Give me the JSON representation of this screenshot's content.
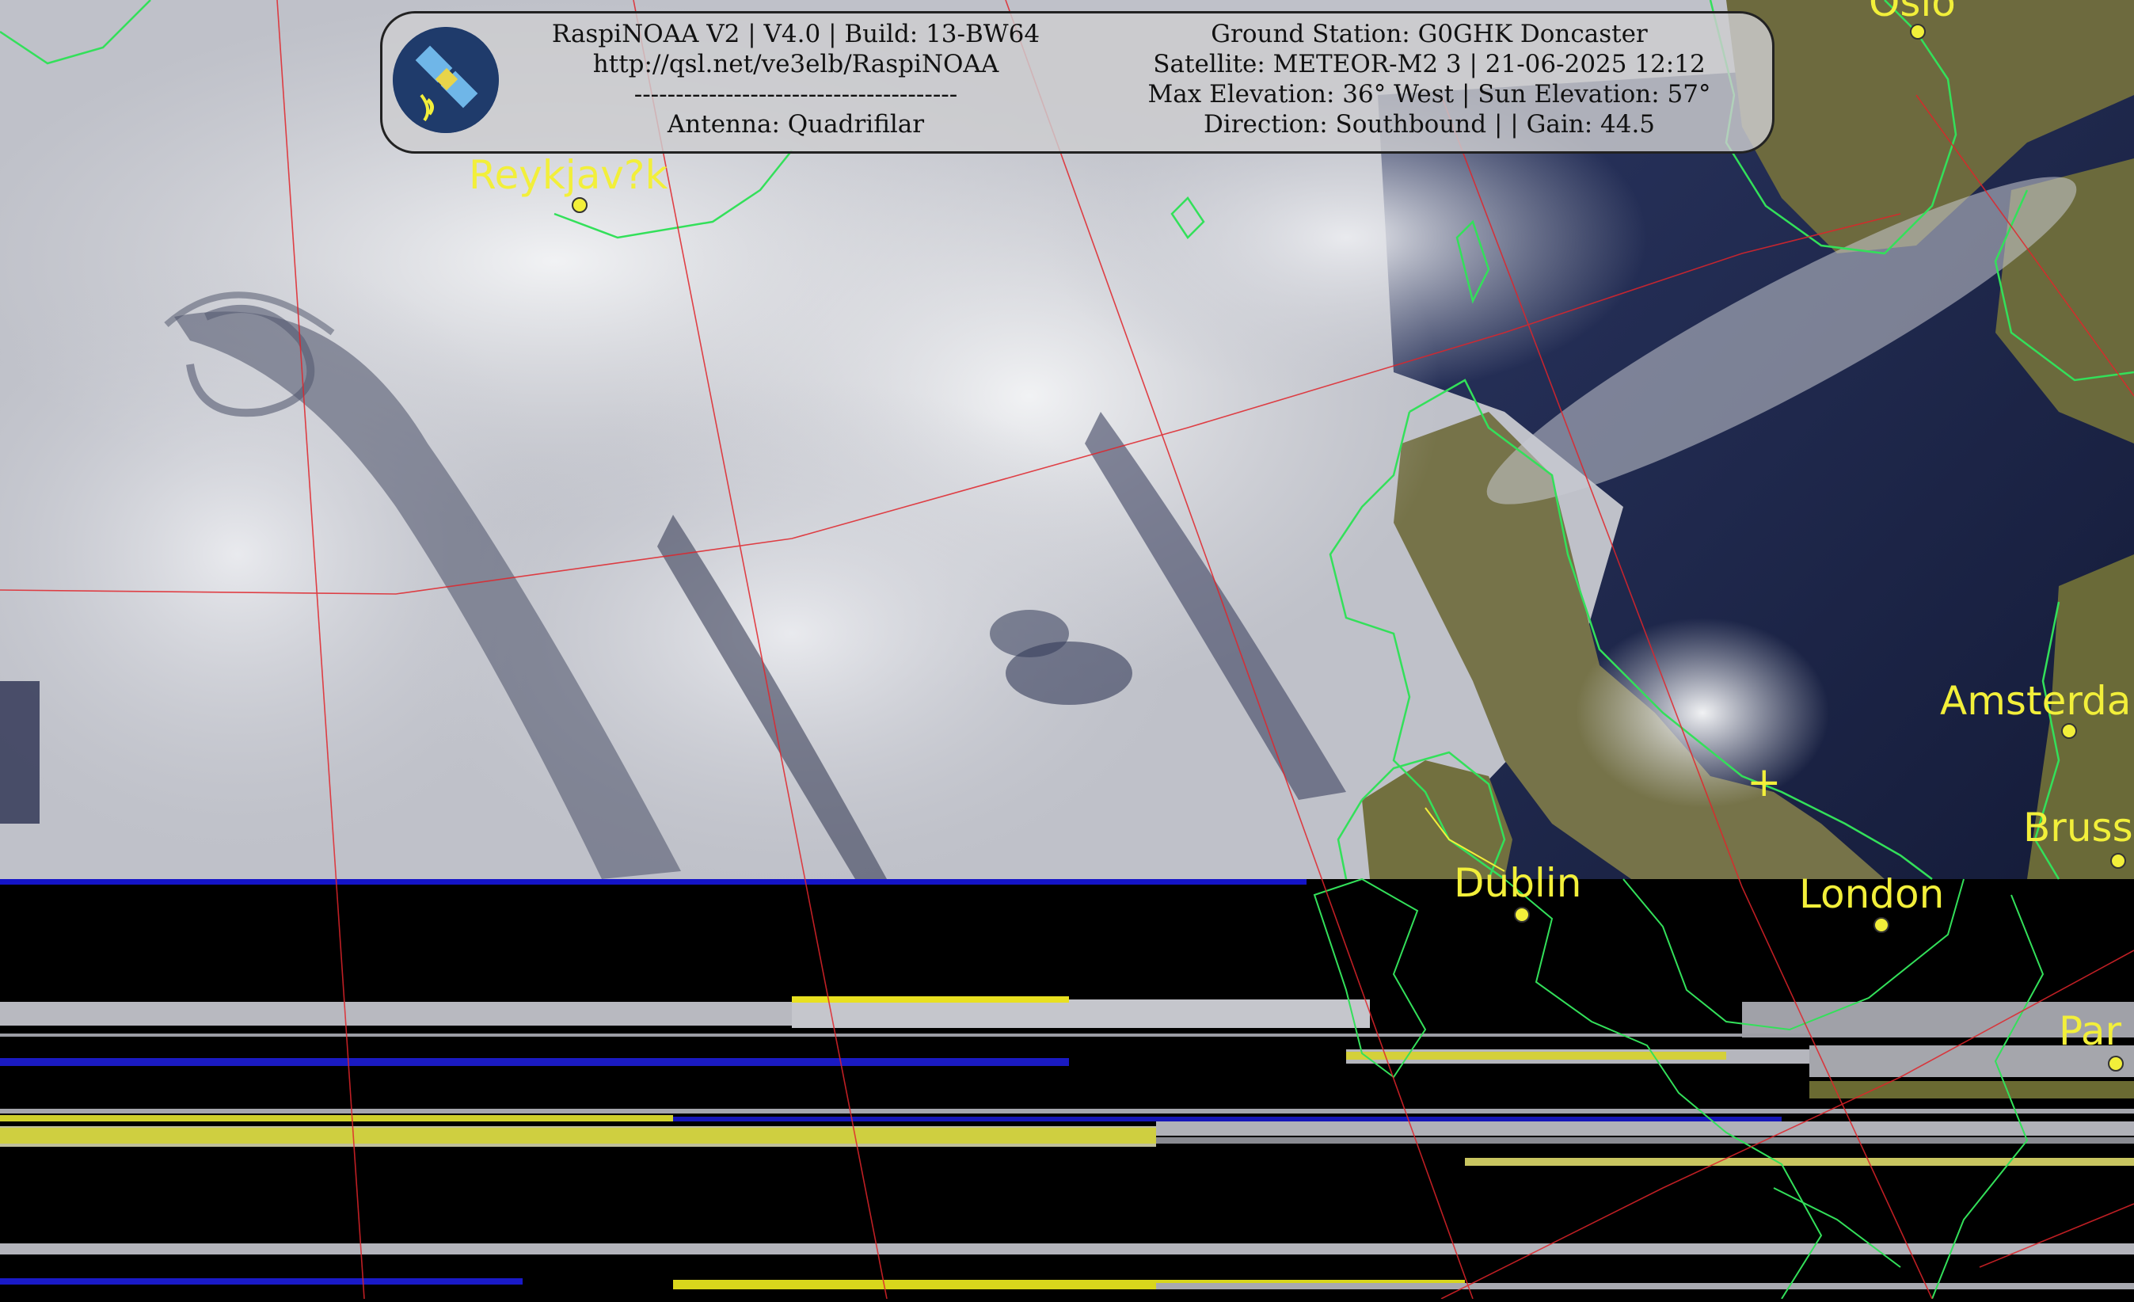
{
  "header": {
    "line1": "RaspiNOAA V2 | V4.0 | Build: 13-BW64",
    "line2": "http://qsl.net/ve3elb/RaspiNOAA",
    "separator": "---------------------------------------",
    "line4": "Antenna: Quadrifilar",
    "station": "Ground Station: G0GHK Doncaster",
    "satellite": "Satellite: METEOR-M2 3 | 21-06-2025 12:12",
    "elevation": "Max Elevation: 36° West | Sun Elevation: 57°",
    "direction": "Direction: Southbound | | Gain: 44.5"
  },
  "cities": {
    "oslo": "Oslo",
    "reykjavik": "Reykjav?k",
    "amsterdam": "Amsterdam",
    "brussels": "Bruss",
    "dublin": "Dublin",
    "london": "London",
    "paris": "Par"
  },
  "colors": {
    "overlay_lines": "#e0242a",
    "coastline": "#33e05a",
    "labels": "#f2ef3a",
    "ocean": "#1c2544",
    "land": "#6a6a3a"
  }
}
